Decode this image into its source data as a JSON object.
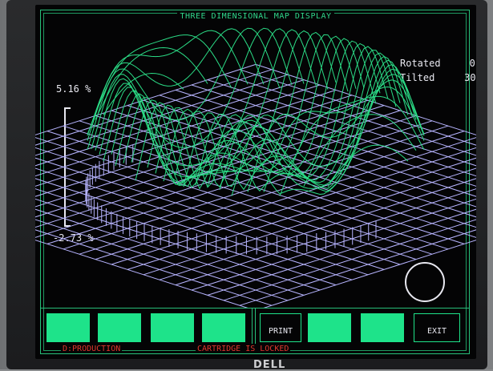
{
  "app": {
    "title": "THREE DIMENSIONAL MAP DISPLAY"
  },
  "orientation": {
    "rotated_label": "Rotated",
    "rotated_value": "0",
    "tilted_label": "Tilted",
    "tilted_value": "30"
  },
  "scale": {
    "max_label": "5.16 %",
    "min_label": "-2.73 %"
  },
  "function_keys": [
    {
      "label": ""
    },
    {
      "label": ""
    },
    {
      "label": ""
    },
    {
      "label": ""
    },
    {
      "label": "PRINT"
    },
    {
      "label": ""
    },
    {
      "label": ""
    },
    {
      "label": "EXIT"
    }
  ],
  "status": {
    "drive": "D:PRODUCTION",
    "cartridge": "CARTRIDGE  IS LOCKED"
  },
  "monitor": {
    "brand": "DELL"
  },
  "colors": {
    "surface": "#2bdc86",
    "base_grid": "#b7b4ff",
    "border": "#27c07a",
    "key": "#1ee38a",
    "status": "#e2382e",
    "text": "#e8e8f0"
  }
}
